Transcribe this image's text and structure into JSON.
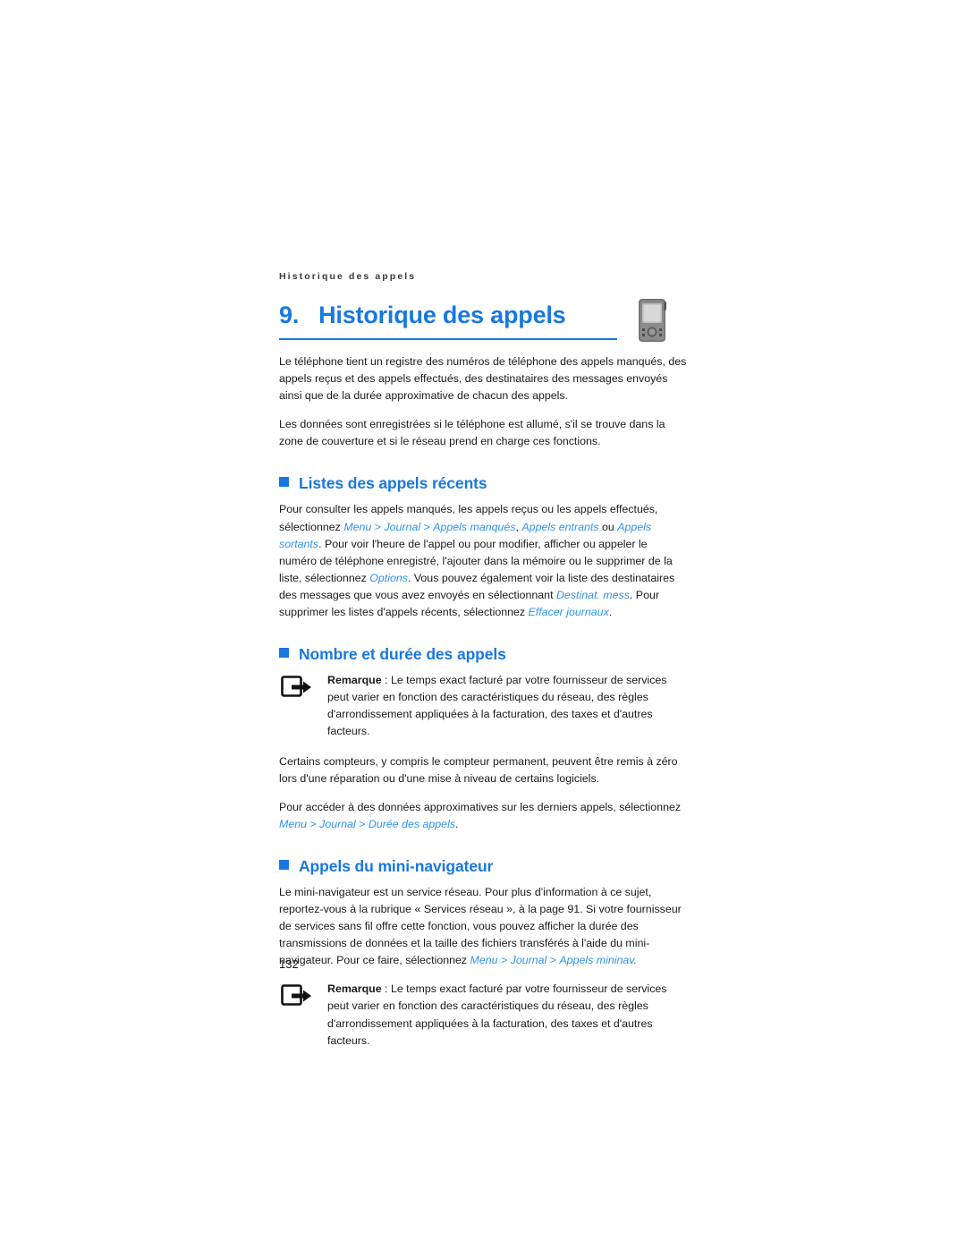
{
  "document": {
    "running_head": "Historique des appels",
    "chapter_number": "9.",
    "chapter_title": "Historique des appels",
    "page_number": "132",
    "accent_color": "#1878e0",
    "link_color": "#2f93f0",
    "device_icon_name": "mobile-phone-icon"
  },
  "intro": {
    "paragraph_1": "Le téléphone tient un registre des numéros de téléphone des appels manqués, des appels reçus et des appels effectués, des destinataires des messages envoyés ainsi que de la durée approximative de chacun des appels.",
    "paragraph_2": "Les données sont enregistrées si le téléphone est allumé, s'il se trouve dans la zone de couverture et si le réseau prend en charge ces fonctions."
  },
  "section_recent_calls": {
    "heading": "Listes des appels récents",
    "text_1": "Pour consulter les appels manqués, les appels reçus ou les appels effectués, sélectionnez ",
    "link_menu": "Menu",
    "sep_1": " > ",
    "link_journal": "Journal",
    "sep_2": " > ",
    "link_missed": "Appels manqués",
    "comma_1": ", ",
    "link_incoming": "Appels entrants",
    "text_or": " ou ",
    "link_outgoing": "Appels sortants",
    "text_2": ". Pour voir l'heure de l'appel ou pour modifier, afficher ou appeler le numéro de téléphone enregistré, l'ajouter dans la mémoire ou le supprimer de la liste, sélectionnez ",
    "link_options": "Options",
    "text_3": ". Vous pouvez également voir la liste des destinataires des messages que vous avez envoyés en sélectionnant ",
    "link_dest": "Destinat. mess",
    "text_4": ". Pour supprimer les listes d'appels récents, sélectionnez ",
    "link_clear": "Effacer journaux",
    "text_5": "."
  },
  "section_count_duration": {
    "heading": "Nombre et durée des appels",
    "note": {
      "label": "Remarque",
      "separator": " : ",
      "text": "Le temps exact facturé par votre fournisseur de services peut varier en fonction des caractéristiques du réseau, des règles d'arrondissement appliquées à la facturation, des taxes et d'autres facteurs."
    },
    "paragraph_1": "Certains compteurs, y compris le compteur permanent, peuvent être remis à zéro lors d'une réparation ou d'une mise à niveau de certains logiciels.",
    "text_1": "Pour accéder à des données approximatives sur les derniers appels, sélectionnez ",
    "link_menu": "Menu",
    "sep_1": " > ",
    "link_journal": "Journal",
    "sep_2": " > ",
    "link_duration": "Durée des appels",
    "text_2": "."
  },
  "section_mini_browser": {
    "heading": "Appels du mini-navigateur",
    "text_1": "Le mini-navigateur est un service réseau. Pour plus d'information à ce sujet, reportez-vous à la rubrique « Services réseau », à la page 91. Si votre fournisseur de services sans fil offre cette fonction, vous pouvez afficher la durée des transmissions de données et la taille des fichiers transférés à l'aide du mini-navigateur. Pour ce faire, sélectionnez ",
    "link_menu": "Menu",
    "sep_1": " > ",
    "link_journal": "Journal",
    "sep_2": " > ",
    "link_mininav": "Appels mininav.",
    "note": {
      "label": "Remarque",
      "separator": " : ",
      "text": "Le temps exact facturé par votre fournisseur de services peut varier en fonction des caractéristiques du réseau, des règles d'arrondissement appliquées à la facturation, des taxes et d'autres facteurs."
    }
  }
}
